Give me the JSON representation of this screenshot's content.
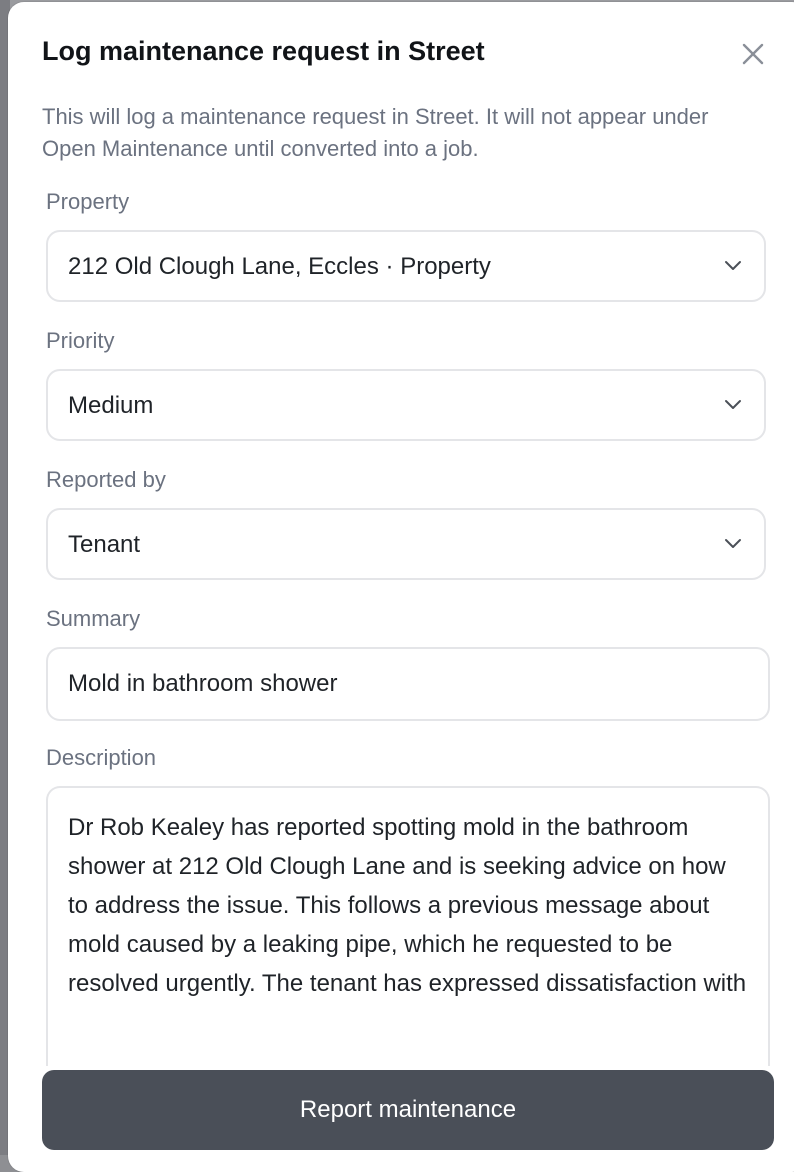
{
  "dialog": {
    "title": "Log maintenance request in Street",
    "subtitle": "This will log a maintenance request in Street. It will not appear under Open Maintenance until converted into a job."
  },
  "fields": {
    "property": {
      "label": "Property",
      "value": "212 Old Clough Lane, Eccles · Property"
    },
    "priority": {
      "label": "Priority",
      "value": "Medium"
    },
    "reported_by": {
      "label": "Reported by",
      "value": "Tenant"
    },
    "summary": {
      "label": "Summary",
      "value": "Mold in bathroom shower"
    },
    "description": {
      "label": "Description",
      "value": "Dr Rob Kealey has reported spotting mold in the bathroom shower at 212 Old Clough Lane and is seeking advice on how to address the issue. This follows a previous message about mold caused by a leaking pipe, which he requested to be resolved urgently. The tenant has expressed dissatisfaction with"
    }
  },
  "actions": {
    "submit_label": "Report maintenance"
  },
  "icons": {
    "close": "close-icon",
    "chevron": "chevron-down-icon"
  },
  "colors": {
    "primary_button": "#4a4f58",
    "muted_text": "#6b7280",
    "border": "#e4e5e8"
  }
}
